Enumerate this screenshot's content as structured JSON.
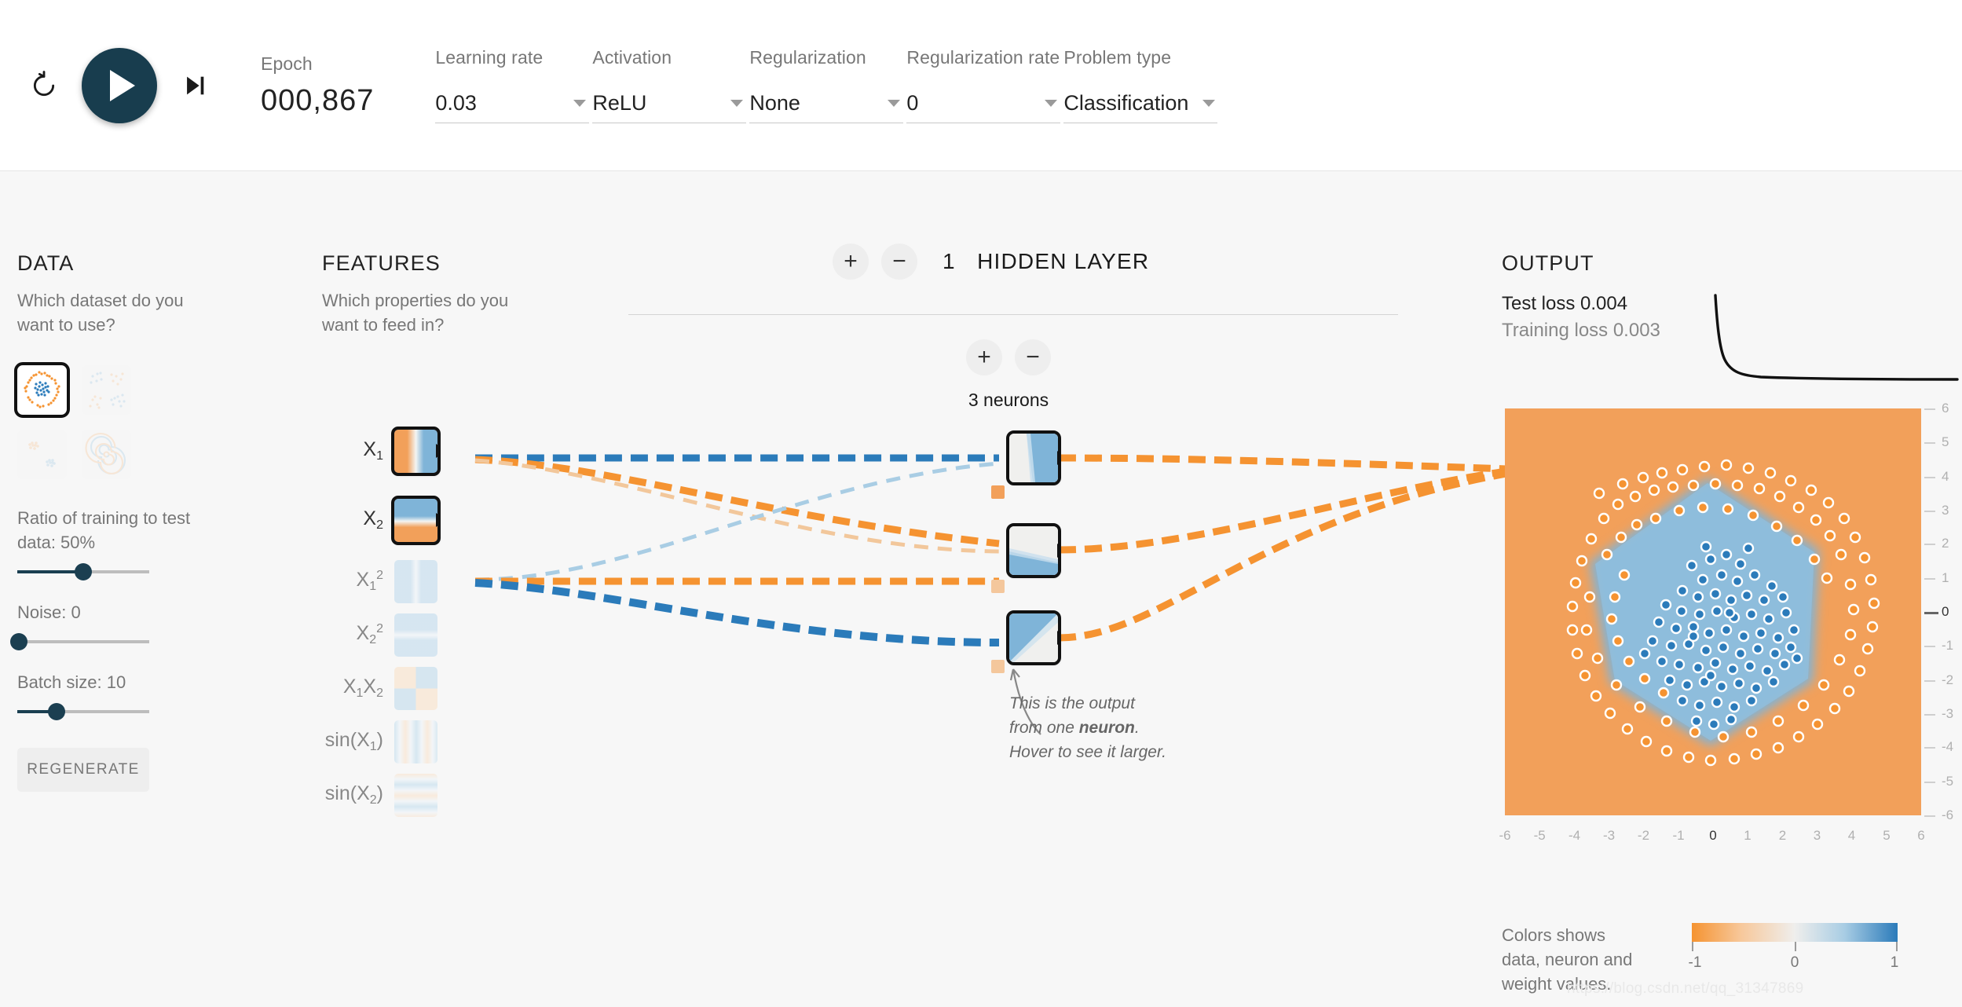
{
  "toolbar": {
    "reset_icon": "reset-icon",
    "play_icon": "play-icon",
    "step_icon": "step-forward-icon",
    "epoch_label": "Epoch",
    "epoch_value": "000,867",
    "controls": [
      {
        "label": "Learning rate",
        "value": "0.03",
        "name": "learning-rate"
      },
      {
        "label": "Activation",
        "value": "ReLU",
        "name": "activation"
      },
      {
        "label": "Regularization",
        "value": "None",
        "name": "regularization"
      },
      {
        "label": "Regularization rate",
        "value": "0",
        "name": "regularization-rate"
      },
      {
        "label": "Problem type",
        "value": "Classification",
        "name": "problem-type"
      }
    ]
  },
  "data": {
    "title": "DATA",
    "subtitle": "Which dataset do you want to use?",
    "datasets": [
      {
        "name": "circle",
        "selected": true
      },
      {
        "name": "exclusive-or",
        "selected": false
      },
      {
        "name": "gaussian",
        "selected": false
      },
      {
        "name": "spiral",
        "selected": false
      }
    ],
    "ratio_label": "Ratio of training to test data:  50%",
    "ratio_percent": 50,
    "noise_label": "Noise:  0",
    "noise_percent": 0,
    "batch_label": "Batch size:  10",
    "batch_percent": 30,
    "regenerate_label": "REGENERATE"
  },
  "features": {
    "title": "FEATURES",
    "subtitle": "Which properties do you want to feed in?",
    "items": [
      {
        "label": "X₁",
        "name": "feature-x1",
        "active": true
      },
      {
        "label": "X₂",
        "name": "feature-x2",
        "active": true
      },
      {
        "label": "X₁²",
        "name": "feature-x1-squared",
        "active": false
      },
      {
        "label": "X₂²",
        "name": "feature-x2-squared",
        "active": false
      },
      {
        "label": "X₁X₂",
        "name": "feature-x1x2",
        "active": false
      },
      {
        "label": "sin(X₁)",
        "name": "feature-sin-x1",
        "active": false
      },
      {
        "label": "sin(X₂)",
        "name": "feature-sin-x2",
        "active": false
      }
    ]
  },
  "network": {
    "add_layer_icon": "plus-icon",
    "remove_layer_icon": "minus-icon",
    "layer_count": "1",
    "layer_word": "HIDDEN LAYER",
    "add_neuron_icon": "plus-icon",
    "remove_neuron_icon": "minus-icon",
    "neuron_count_label": "3 neurons",
    "tooltip_part1": "This is the output from one ",
    "tooltip_bold": "neuron",
    "tooltip_part2": ". Hover to see it larger."
  },
  "output": {
    "title": "OUTPUT",
    "test_loss": "Test loss 0.004",
    "training_loss": "Training loss 0.003",
    "axis_ticks": [
      "-6",
      "-5",
      "-4",
      "-3",
      "-2",
      "-1",
      "0",
      "1",
      "2",
      "3",
      "4",
      "5",
      "6"
    ],
    "legend_text": "Colors shows data, neuron and weight values.",
    "legend_ticks": [
      "-1",
      "0",
      "1"
    ]
  },
  "watermark": "https://blog.csdn.net/qq_31347869",
  "colors": {
    "blue": "#2b7bba",
    "orange": "#f59331",
    "dark": "#183d4e",
    "light_blue": "#a9cde4",
    "light_orange": "#f7c89b"
  },
  "chart_data": {
    "type": "line",
    "title": "",
    "series": [
      {
        "name": "loss",
        "values": [
          1.0,
          0.22,
          0.06,
          0.03,
          0.02,
          0.015,
          0.012,
          0.01,
          0.008,
          0.006,
          0.005,
          0.004
        ]
      }
    ],
    "x": [
      0,
      0.05,
      0.1,
      0.15,
      0.2,
      0.3,
      0.4,
      0.5,
      0.6,
      0.7,
      0.85,
      1.0
    ],
    "xlabel": "",
    "ylabel": "",
    "ylim": [
      0,
      1
    ],
    "grid": false,
    "legend": "none"
  }
}
